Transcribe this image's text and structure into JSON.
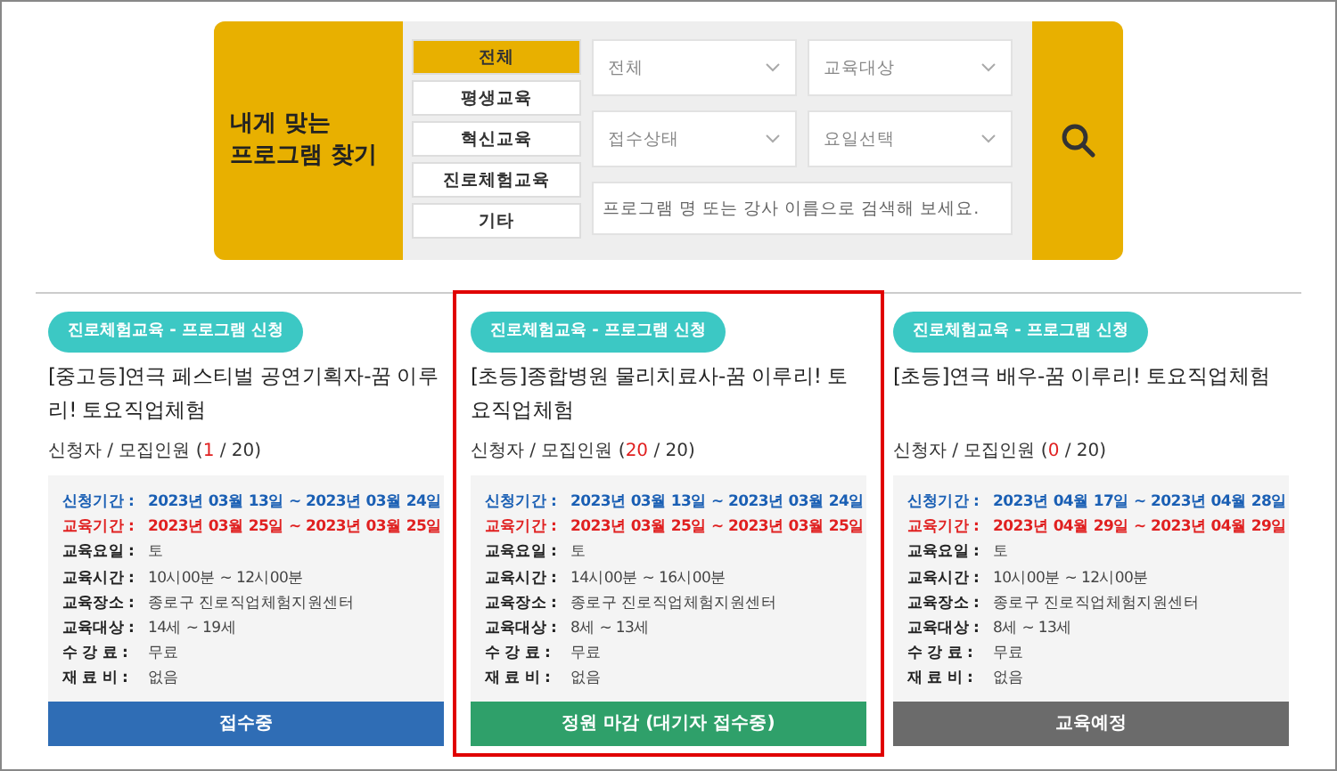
{
  "finder": {
    "title": "내게 맞는\n프로그램 찾기",
    "categories": [
      {
        "label": "전체",
        "selected": true
      },
      {
        "label": "평생교육",
        "selected": false
      },
      {
        "label": "혁신교육",
        "selected": false
      },
      {
        "label": "진로체험교육",
        "selected": false
      },
      {
        "label": "기타",
        "selected": false
      }
    ],
    "selects": [
      {
        "placeholder": "전체"
      },
      {
        "placeholder": "교육대상"
      },
      {
        "placeholder": "접수상태"
      },
      {
        "placeholder": "요일선택"
      }
    ],
    "search": {
      "placeholder": "프로그램 명 또는 강사 이름으로 검색해 보세요."
    }
  },
  "programs": [
    {
      "badge": "진로체험교육 - 프로그램 신청",
      "title": "[중고등]연극 페스티벌 공연기획자-꿈 이루리! 토요직업체험",
      "applicants": "신청자 / 모집인원 (**1** / 20)",
      "highlighted": false,
      "details": [
        {
          "kind": "apply",
          "label": "신청기간 :",
          "value": "2023년 03월 13일 ~ 2023년 03월 24일"
        },
        {
          "kind": "period",
          "label": "교육기간 :",
          "value": "2023년 03월 25일 ~ 2023년 03월 25일"
        },
        {
          "kind": "plain",
          "label": "교육요일 :",
          "value": "토"
        },
        {
          "kind": "plain",
          "label": "교육시간 :",
          "value": "10시00분 ~ 12시00분"
        },
        {
          "kind": "plain",
          "label": "교육장소 :",
          "value": "종로구 진로직업체험지원센터"
        },
        {
          "kind": "plain",
          "label": "교육대상 :",
          "value": "14세 ~ 19세"
        },
        {
          "kind": "plain",
          "label": "수 강 료 :",
          "value": "무료"
        },
        {
          "kind": "plain",
          "label": "재 료 비 :",
          "value": "없음"
        }
      ],
      "status": {
        "kind": "open",
        "label": "접수중"
      }
    },
    {
      "badge": "진로체험교육 - 프로그램 신청",
      "title": "[초등]종합병원 물리치료사-꿈 이루리! 토요직업체험",
      "applicants": "신청자 / 모집인원 (**20** / 20)",
      "highlighted": true,
      "details": [
        {
          "kind": "apply",
          "label": "신청기간 :",
          "value": "2023년 03월 13일 ~ 2023년 03월 24일"
        },
        {
          "kind": "period",
          "label": "교육기간 :",
          "value": "2023년 03월 25일 ~ 2023년 03월 25일"
        },
        {
          "kind": "plain",
          "label": "교육요일 :",
          "value": "토"
        },
        {
          "kind": "plain",
          "label": "교육시간 :",
          "value": "14시00분 ~ 16시00분"
        },
        {
          "kind": "plain",
          "label": "교육장소 :",
          "value": "종로구 진로직업체험지원센터"
        },
        {
          "kind": "plain",
          "label": "교육대상 :",
          "value": "8세 ~ 13세"
        },
        {
          "kind": "plain",
          "label": "수 강 료 :",
          "value": "무료"
        },
        {
          "kind": "plain",
          "label": "재 료 비 :",
          "value": "없음"
        }
      ],
      "status": {
        "kind": "full",
        "label": "정원 마감 (대기자 접수중)"
      }
    },
    {
      "badge": "진로체험교육 - 프로그램 신청",
      "title": "[초등]연극 배우-꿈 이루리! 토요직업체험",
      "applicants": "신청자 / 모집인원 (**0** / 20)",
      "highlighted": false,
      "details": [
        {
          "kind": "apply",
          "label": "신청기간 :",
          "value": "2023년 04월 17일 ~ 2023년 04월 28일"
        },
        {
          "kind": "period",
          "label": "교육기간 :",
          "value": "2023년 04월 29일 ~ 2023년 04월 29일"
        },
        {
          "kind": "plain",
          "label": "교육요일 :",
          "value": "토"
        },
        {
          "kind": "plain",
          "label": "교육시간 :",
          "value": "10시00분 ~ 12시00분"
        },
        {
          "kind": "plain",
          "label": "교육장소 :",
          "value": "종로구 진로직업체험지원센터"
        },
        {
          "kind": "plain",
          "label": "교육대상 :",
          "value": "8세 ~ 13세"
        },
        {
          "kind": "plain",
          "label": "수 강 료 :",
          "value": "무료"
        },
        {
          "kind": "plain",
          "label": "재 료 비 :",
          "value": "없음"
        }
      ],
      "status": {
        "kind": "upcoming",
        "label": "교육예정"
      }
    }
  ]
}
